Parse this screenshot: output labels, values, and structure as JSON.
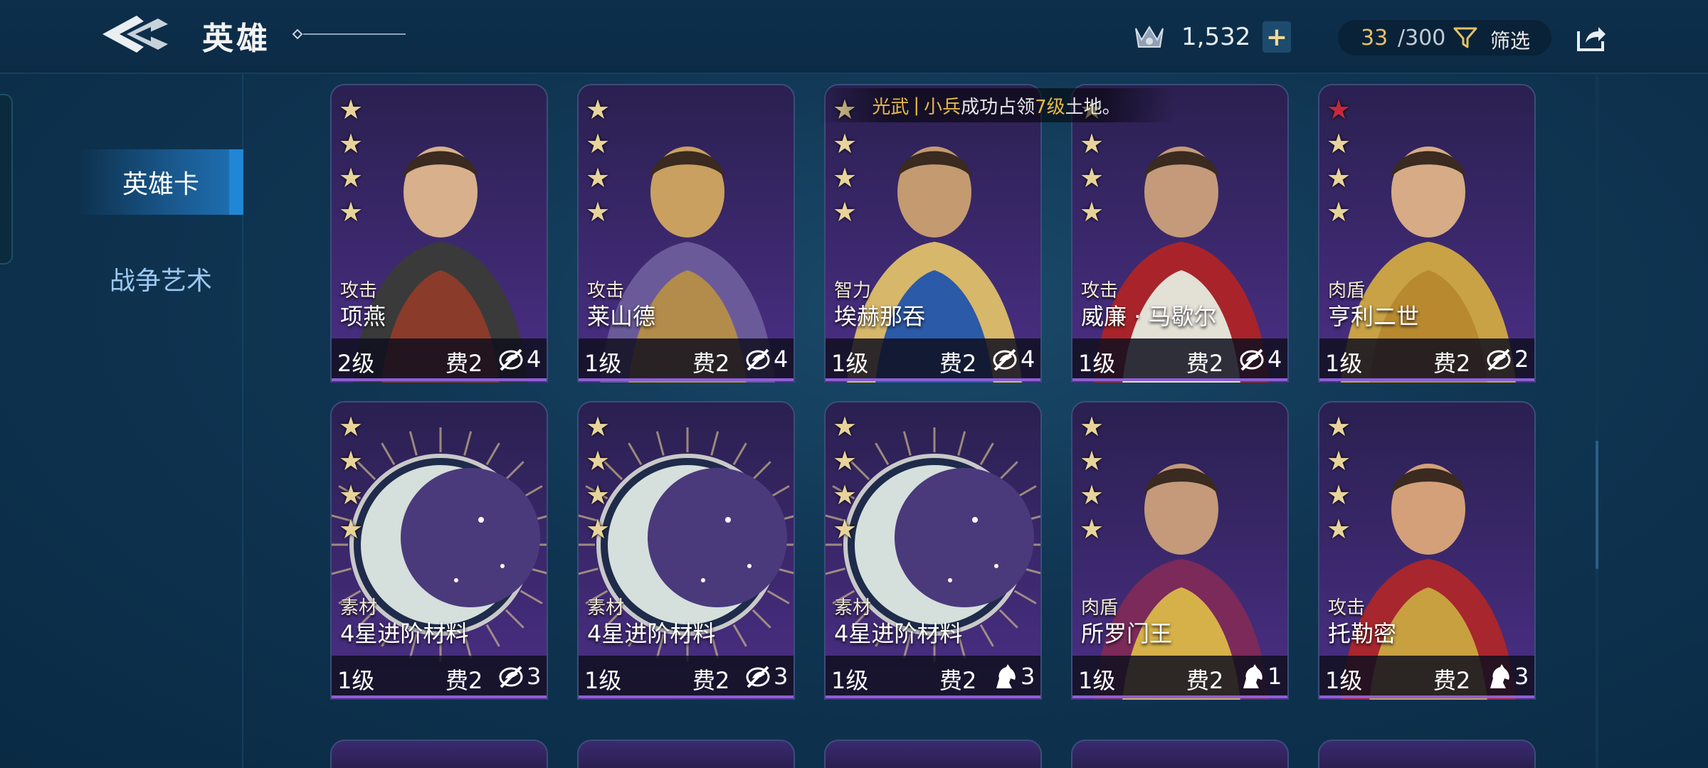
{
  "header": {
    "title": "英雄",
    "currency_amount": "1,532",
    "add_label": "+",
    "count_current": "33",
    "count_total": "/300",
    "filter_label": "筛选"
  },
  "sidebar": {
    "tabs": [
      {
        "label": "英雄卡",
        "active": true
      },
      {
        "label": "战争艺术",
        "active": false
      }
    ]
  },
  "toast": {
    "player": "光武",
    "sep": "|",
    "unit": "小兵",
    "text1": "成功占领",
    "level": "7级",
    "text2": "土地。"
  },
  "cards": [
    {
      "stars": 4,
      "red_stars": 0,
      "role": "攻击",
      "name": "项燕",
      "level": "2级",
      "cost": "费2",
      "type": "no-mount",
      "power": "4",
      "portrait": "warrior-armor"
    },
    {
      "stars": 4,
      "red_stars": 0,
      "role": "攻击",
      "name": "莱山德",
      "level": "1级",
      "cost": "费2",
      "type": "no-mount",
      "power": "4",
      "portrait": "spartan"
    },
    {
      "stars": 4,
      "red_stars": 0,
      "role": "智力",
      "name": "埃赫那吞",
      "level": "1级",
      "cost": "费2",
      "type": "no-mount",
      "power": "4",
      "portrait": "pharaoh"
    },
    {
      "stars": 4,
      "red_stars": 0,
      "role": "攻击",
      "name": "威廉 · 马歇尔",
      "level": "1级",
      "cost": "费2",
      "type": "no-mount",
      "power": "4",
      "portrait": "knight"
    },
    {
      "stars": 4,
      "red_stars": 1,
      "role": "肉盾",
      "name": "亨利二世",
      "level": "1级",
      "cost": "费2",
      "type": "no-mount",
      "power": "2",
      "portrait": "king"
    },
    {
      "stars": 4,
      "red_stars": 0,
      "role": "素材",
      "name": "4星进阶材料",
      "level": "1级",
      "cost": "费2",
      "type": "no-mount",
      "power": "3",
      "portrait": "moon"
    },
    {
      "stars": 4,
      "red_stars": 0,
      "role": "素材",
      "name": "4星进阶材料",
      "level": "1级",
      "cost": "费2",
      "type": "no-mount",
      "power": "3",
      "portrait": "moon"
    },
    {
      "stars": 4,
      "red_stars": 0,
      "role": "素材",
      "name": "4星进阶材料",
      "level": "1级",
      "cost": "费2",
      "type": "horse",
      "power": "3",
      "portrait": "moon"
    },
    {
      "stars": 4,
      "red_stars": 0,
      "role": "肉盾",
      "name": "所罗门王",
      "level": "1级",
      "cost": "费2",
      "type": "horse",
      "power": "1",
      "portrait": "solomon"
    },
    {
      "stars": 4,
      "red_stars": 0,
      "role": "攻击",
      "name": "托勒密",
      "level": "1级",
      "cost": "费2",
      "type": "horse",
      "power": "3",
      "portrait": "ptolemy"
    }
  ],
  "colors": {
    "accent_gold": "#e6b84a",
    "tab_active": "#1e72b8",
    "card_border_bottom": "#8e5fd6"
  }
}
